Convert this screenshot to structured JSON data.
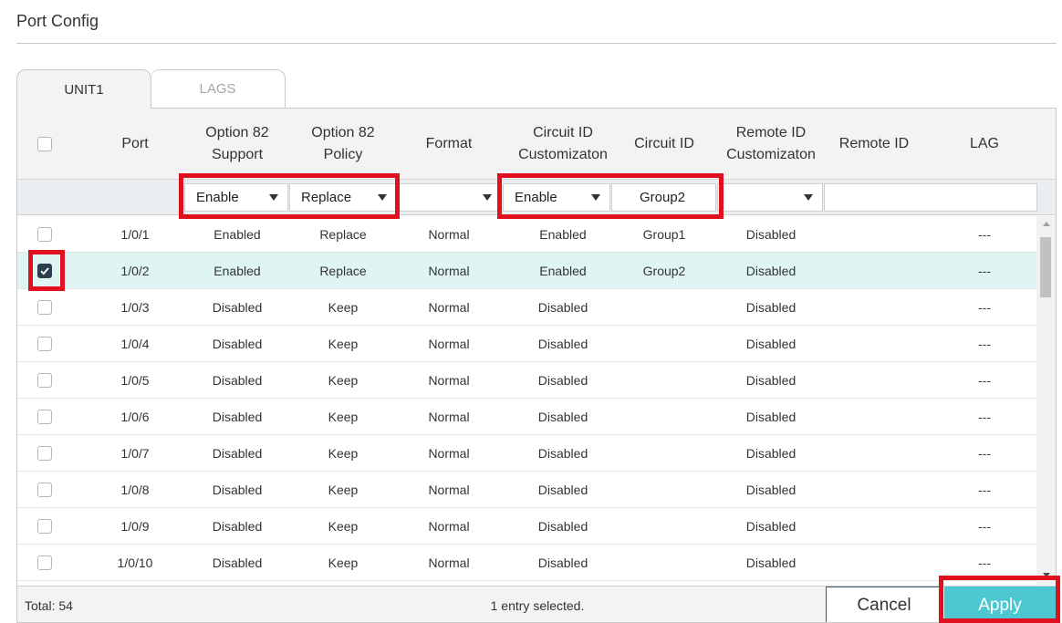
{
  "page": {
    "title": "Port Config"
  },
  "tabs": [
    {
      "label": "UNIT1",
      "active": true
    },
    {
      "label": "LAGS",
      "active": false
    }
  ],
  "columns": [
    {
      "key": "port",
      "line1": "Port",
      "line2": ""
    },
    {
      "key": "option82_support",
      "line1": "Option 82",
      "line2": "Support"
    },
    {
      "key": "option82_policy",
      "line1": "Option 82",
      "line2": "Policy"
    },
    {
      "key": "format",
      "line1": "Format",
      "line2": ""
    },
    {
      "key": "circuit_id_customization",
      "line1": "Circuit ID",
      "line2": "Customizaton"
    },
    {
      "key": "circuit_id",
      "line1": "Circuit ID",
      "line2": ""
    },
    {
      "key": "remote_id_customization",
      "line1": "Remote ID",
      "line2": "Customizaton"
    },
    {
      "key": "remote_id",
      "line1": "Remote ID",
      "line2": ""
    },
    {
      "key": "lag",
      "line1": "LAG",
      "line2": ""
    }
  ],
  "filters": {
    "option82_support": "Enable",
    "option82_policy": "Replace",
    "format": "",
    "circuit_id_customization": "Enable",
    "circuit_id": "Group2",
    "remote_id_customization": ""
  },
  "rows": [
    {
      "checked": false,
      "port": "1/0/1",
      "option82_support": "Enabled",
      "option82_policy": "Replace",
      "format": "Normal",
      "circuit_id_customization": "Enabled",
      "circuit_id": "Group1",
      "remote_id_customization": "Disabled",
      "remote_id": "",
      "lag": "---"
    },
    {
      "checked": true,
      "port": "1/0/2",
      "option82_support": "Enabled",
      "option82_policy": "Replace",
      "format": "Normal",
      "circuit_id_customization": "Enabled",
      "circuit_id": "Group2",
      "remote_id_customization": "Disabled",
      "remote_id": "",
      "lag": "---"
    },
    {
      "checked": false,
      "port": "1/0/3",
      "option82_support": "Disabled",
      "option82_policy": "Keep",
      "format": "Normal",
      "circuit_id_customization": "Disabled",
      "circuit_id": "",
      "remote_id_customization": "Disabled",
      "remote_id": "",
      "lag": "---"
    },
    {
      "checked": false,
      "port": "1/0/4",
      "option82_support": "Disabled",
      "option82_policy": "Keep",
      "format": "Normal",
      "circuit_id_customization": "Disabled",
      "circuit_id": "",
      "remote_id_customization": "Disabled",
      "remote_id": "",
      "lag": "---"
    },
    {
      "checked": false,
      "port": "1/0/5",
      "option82_support": "Disabled",
      "option82_policy": "Keep",
      "format": "Normal",
      "circuit_id_customization": "Disabled",
      "circuit_id": "",
      "remote_id_customization": "Disabled",
      "remote_id": "",
      "lag": "---"
    },
    {
      "checked": false,
      "port": "1/0/6",
      "option82_support": "Disabled",
      "option82_policy": "Keep",
      "format": "Normal",
      "circuit_id_customization": "Disabled",
      "circuit_id": "",
      "remote_id_customization": "Disabled",
      "remote_id": "",
      "lag": "---"
    },
    {
      "checked": false,
      "port": "1/0/7",
      "option82_support": "Disabled",
      "option82_policy": "Keep",
      "format": "Normal",
      "circuit_id_customization": "Disabled",
      "circuit_id": "",
      "remote_id_customization": "Disabled",
      "remote_id": "",
      "lag": "---"
    },
    {
      "checked": false,
      "port": "1/0/8",
      "option82_support": "Disabled",
      "option82_policy": "Keep",
      "format": "Normal",
      "circuit_id_customization": "Disabled",
      "circuit_id": "",
      "remote_id_customization": "Disabled",
      "remote_id": "",
      "lag": "---"
    },
    {
      "checked": false,
      "port": "1/0/9",
      "option82_support": "Disabled",
      "option82_policy": "Keep",
      "format": "Normal",
      "circuit_id_customization": "Disabled",
      "circuit_id": "",
      "remote_id_customization": "Disabled",
      "remote_id": "",
      "lag": "---"
    },
    {
      "checked": false,
      "port": "1/0/10",
      "option82_support": "Disabled",
      "option82_policy": "Keep",
      "format": "Normal",
      "circuit_id_customization": "Disabled",
      "circuit_id": "",
      "remote_id_customization": "Disabled",
      "remote_id": "",
      "lag": "---"
    }
  ],
  "footer": {
    "total": "Total: 54",
    "selected_info": "1 entry selected.",
    "cancel_label": "Cancel",
    "apply_label": "Apply"
  },
  "colors": {
    "accent": "#4dc8d2",
    "highlight": "#e0101e",
    "selected_row": "#dff5f4",
    "checkbox_checked": "#2d3d52"
  }
}
